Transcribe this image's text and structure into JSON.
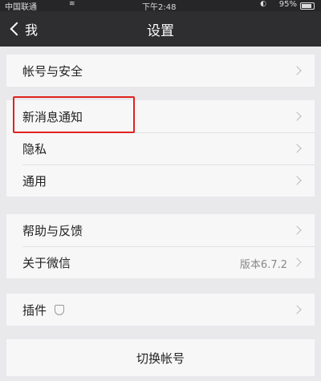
{
  "status_bar": {
    "carrier": "中国联通",
    "time": "下午2:48",
    "battery": "95%"
  },
  "nav": {
    "back_label": "我",
    "title": "设置"
  },
  "groups": [
    {
      "items": [
        {
          "label": "帐号与安全"
        }
      ]
    },
    {
      "items": [
        {
          "label": "新消息通知"
        },
        {
          "label": "隐私"
        },
        {
          "label": "通用"
        }
      ]
    },
    {
      "items": [
        {
          "label": "帮助与反馈"
        },
        {
          "label": "关于微信",
          "value": "版本6.7.2"
        }
      ]
    },
    {
      "items": [
        {
          "label": "插件"
        }
      ]
    }
  ],
  "switch_account": "切换帐号",
  "highlight_color": "#e0221e"
}
